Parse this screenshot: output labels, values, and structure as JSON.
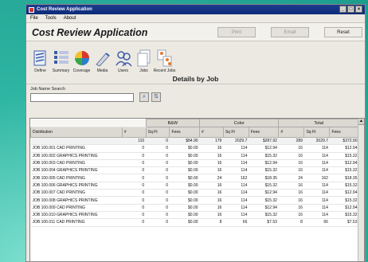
{
  "window": {
    "title": "Cost Review Application"
  },
  "menu": [
    "File",
    "Tools",
    "About"
  ],
  "header": {
    "app_title": "Cost Review Application",
    "print": "Print",
    "email": "Email",
    "reset": "Reset"
  },
  "toolbar": {
    "items": [
      {
        "label": "Define",
        "icon": "define-icon"
      },
      {
        "label": "Summary",
        "icon": "summary-icon"
      },
      {
        "label": "Coverage",
        "icon": "coverage-icon"
      },
      {
        "label": "Media",
        "icon": "media-icon"
      },
      {
        "label": "Users",
        "icon": "users-icon"
      },
      {
        "label": "Jobs",
        "icon": "jobs-icon"
      },
      {
        "label": "Recent Jobs",
        "icon": "recent-jobs-icon"
      }
    ]
  },
  "section_title": "Details by Job",
  "search": {
    "label": "Job Name Search",
    "value": "",
    "placeholder": ""
  },
  "table": {
    "groups": [
      "B&W",
      "Color",
      "Total"
    ],
    "columns": [
      "Distribution",
      "#",
      "Sq Ft",
      "Fees",
      "#",
      "Sq Ft",
      "Fees",
      "#",
      "Sq Ft",
      "Fees"
    ],
    "total": [
      "",
      "110",
      "0",
      "$84.90",
      "179",
      "2029.7",
      "$287.92",
      "289",
      "2029.7",
      "$372.90"
    ],
    "rows": [
      [
        "JOB 100.001 CAD PRINTING",
        "0",
        "0",
        "$0.00",
        "16",
        "114",
        "$12.94",
        "16",
        "114",
        "$12.94"
      ],
      [
        "JOB 100.002 GRAPHICS PRINTING",
        "0",
        "0",
        "$0.00",
        "16",
        "114",
        "$15.32",
        "16",
        "114",
        "$15.32"
      ],
      [
        "JOB 100.003 CAD PRINTING",
        "0",
        "0",
        "$0.00",
        "16",
        "114",
        "$12.94",
        "16",
        "114",
        "$12.94"
      ],
      [
        "JOB 100.004 GRAPHICS PRINTING",
        "0",
        "0",
        "$0.00",
        "16",
        "114",
        "$15.32",
        "16",
        "114",
        "$15.32"
      ],
      [
        "JOB 100.005 CAD PRINTING",
        "0",
        "0",
        "$0.00",
        "24",
        "162",
        "$18.35",
        "24",
        "162",
        "$18.35"
      ],
      [
        "JOB 100.006 GRAPHICS PRINTING",
        "0",
        "0",
        "$0.00",
        "16",
        "114",
        "$15.32",
        "16",
        "114",
        "$15.32"
      ],
      [
        "JOB 100.007 CAD PRINTING",
        "0",
        "0",
        "$0.00",
        "16",
        "114",
        "$12.94",
        "16",
        "114",
        "$12.94"
      ],
      [
        "JOB 100.008 GRAPHICS PRINTING",
        "0",
        "0",
        "$0.00",
        "16",
        "114",
        "$15.32",
        "16",
        "114",
        "$15.32"
      ],
      [
        "JOB 100.009 CAD PRINTING",
        "0",
        "0",
        "$0.00",
        "16",
        "114",
        "$12.94",
        "16",
        "114",
        "$12.94"
      ],
      [
        "JOB 100.010 GRAPHICS PRINTING",
        "0",
        "0",
        "$0.00",
        "16",
        "114",
        "$15.32",
        "16",
        "114",
        "$15.32"
      ],
      [
        "JOB 100.011 CAD PRINTING",
        "0",
        "0",
        "$0.00",
        "8",
        "66",
        "$7.53",
        "8",
        "66",
        "$7.53"
      ]
    ]
  }
}
